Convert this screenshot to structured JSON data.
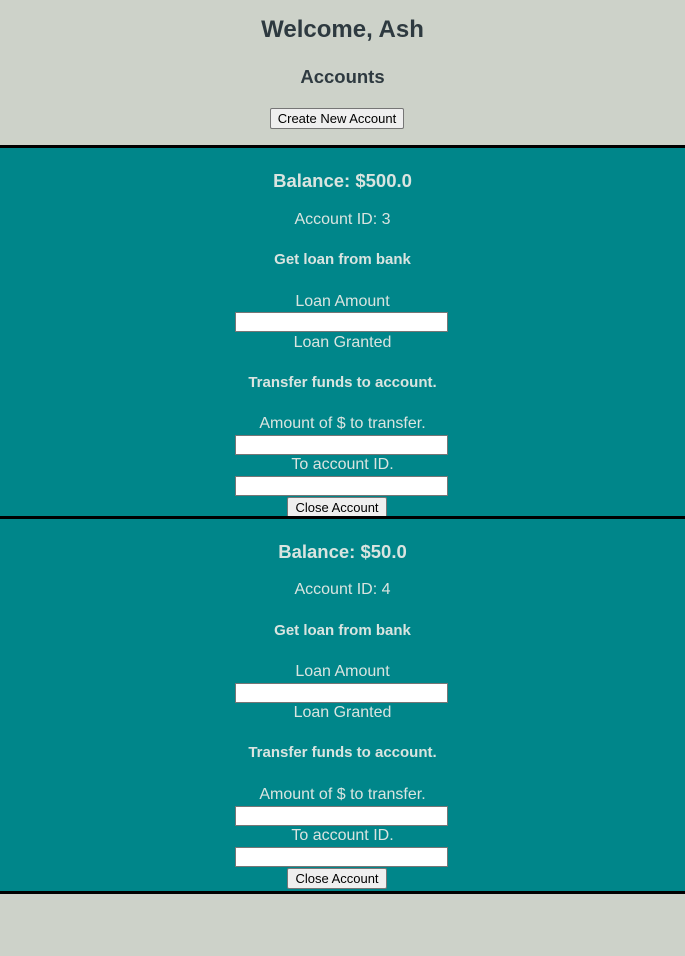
{
  "header": {
    "welcome": "Welcome, Ash",
    "accounts_title": "Accounts",
    "create_button": "Create New Account"
  },
  "accounts": [
    {
      "balance": "Balance: $500.0",
      "account_id": "Account ID: 3",
      "loan_heading": "Get loan from bank",
      "loan_amount_label": "Loan Amount",
      "loan_amount_value": "",
      "loan_status": "Loan Granted",
      "transfer_heading": "Transfer funds to account.",
      "transfer_amount_label": "Amount of $ to transfer.",
      "transfer_amount_value": "",
      "to_account_label": "To account ID.",
      "to_account_value": "",
      "close_button": "Close Account"
    },
    {
      "balance": "Balance: $50.0",
      "account_id": "Account ID: 4",
      "loan_heading": "Get loan from bank",
      "loan_amount_label": "Loan Amount",
      "loan_amount_value": "",
      "loan_status": "Loan Granted",
      "transfer_heading": "Transfer funds to account.",
      "transfer_amount_label": "Amount of $ to transfer.",
      "transfer_amount_value": "",
      "to_account_label": "To account ID.",
      "to_account_value": "",
      "close_button": "Close Account"
    }
  ],
  "colors": {
    "page_background": "#cdd2c9",
    "account_background": "#00868a",
    "account_text": "#d9e4e0",
    "header_text": "#2e3a40",
    "account_border": "#000000"
  }
}
